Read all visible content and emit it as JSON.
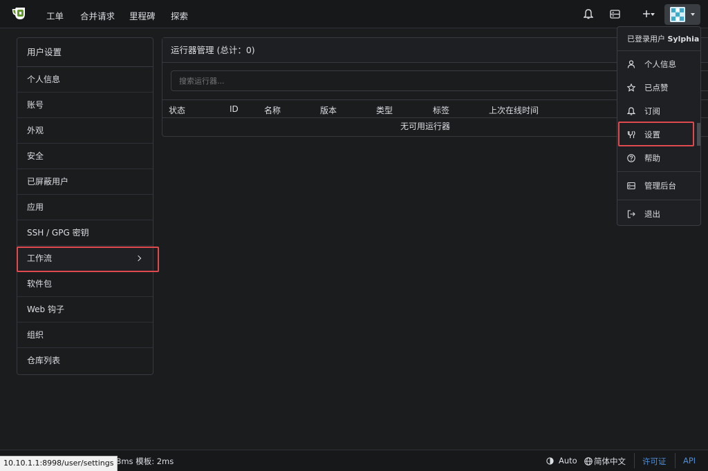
{
  "nav": {
    "logo_icon": "gitea-teapot-logo",
    "links": [
      "工单",
      "合并请求",
      "里程碑",
      "探索"
    ],
    "icons": [
      "bell-icon",
      "site-admin-icon",
      "plus-icon"
    ],
    "accent": "#609926"
  },
  "sidebar": {
    "title": "用户设置",
    "items": [
      {
        "label": "个人信息"
      },
      {
        "label": "账号"
      },
      {
        "label": "外观"
      },
      {
        "label": "安全"
      },
      {
        "label": "已屏蔽用户"
      },
      {
        "label": "应用"
      },
      {
        "label": "SSH / GPG 密钥"
      },
      {
        "label": "工作流"
      },
      {
        "label": "软件包"
      },
      {
        "label": "Web 钩子"
      },
      {
        "label": "组织"
      },
      {
        "label": "仓库列表"
      }
    ],
    "expanded_item": "工作流"
  },
  "runners": {
    "title": "运行器管理 (总计：0)",
    "search_placeholder": "搜索运行器...",
    "columns": [
      "状态",
      "ID",
      "名称",
      "版本",
      "类型",
      "标签",
      "上次在线时间"
    ],
    "empty_text": "无可用运行器"
  },
  "user_menu": {
    "header_prefix": "已登录用户",
    "username": "Sylphia",
    "items": [
      {
        "label": "个人信息",
        "icon": "person-icon"
      },
      {
        "label": "已点赞",
        "icon": "star-icon"
      },
      {
        "label": "订阅",
        "icon": "bell-icon"
      },
      {
        "label": "设置",
        "icon": "tools-icon"
      },
      {
        "label": "帮助",
        "icon": "question-icon"
      },
      {
        "label": "管理后台",
        "icon": "server-icon"
      },
      {
        "label": "退出",
        "icon": "sign-out-icon"
      }
    ]
  },
  "footer": {
    "status_url": "10.10.1.1:8998/user/settings",
    "timing": "面: 8ms 模板: 2ms",
    "theme": "Auto",
    "language": "简体中文",
    "license": "许可证",
    "api": "API"
  },
  "colors": {
    "highlight": "#e0494d",
    "link": "#4c8ed9",
    "background": "#1b1c1e"
  }
}
